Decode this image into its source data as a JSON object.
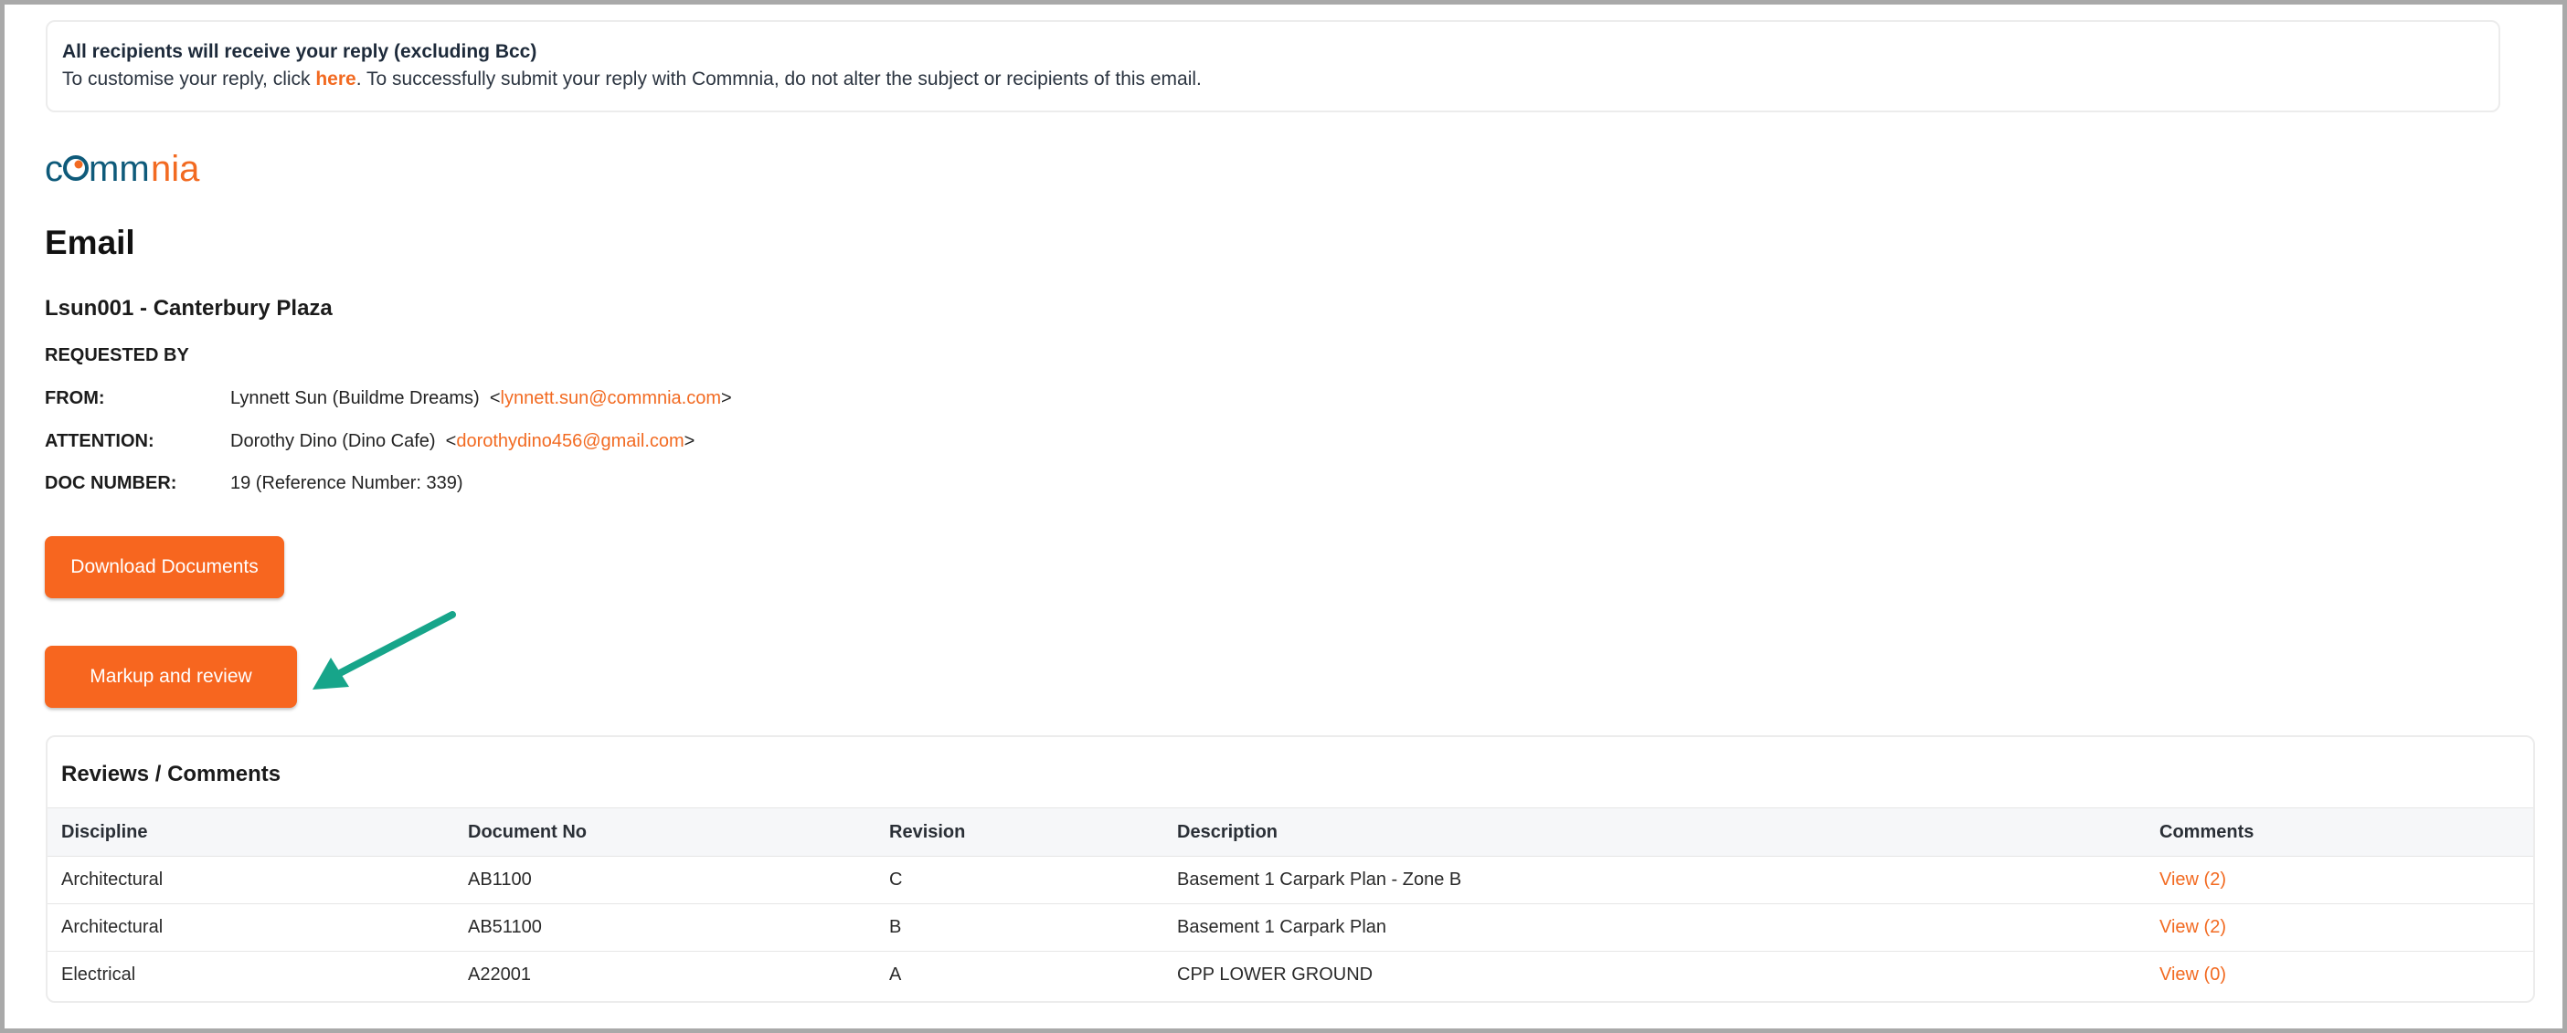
{
  "notice": {
    "title": "All recipients will receive your reply (excluding Bcc)",
    "body_prefix": "To customise your reply, click ",
    "link_text": "here",
    "body_suffix": ". To successfully submit your reply with Commnia, do not alter the subject or recipients of this email."
  },
  "logo": {
    "text": "commnia",
    "colors": {
      "primary": "#0e5a7a",
      "accent": "#f26a21"
    }
  },
  "page_title": "Email",
  "project_title": "Lsun001 - Canterbury Plaza",
  "requested_by_label": "REQUESTED BY",
  "from": {
    "label": "FROM:",
    "name": "Lynnett Sun  (Buildme Dreams)",
    "email": "lynnett.sun@commnia.com"
  },
  "attention": {
    "label": "ATTENTION:",
    "name": "Dorothy Dino (Dino Cafe)",
    "email": "dorothydino456@gmail.com"
  },
  "doc_number": {
    "label": "DOC NUMBER:",
    "value": "19 (Reference Number: 339)"
  },
  "buttons": {
    "download": "Download Documents",
    "markup": "Markup and review"
  },
  "reviews": {
    "title": "Reviews / Comments",
    "columns": [
      "Discipline",
      "Document No",
      "Revision",
      "Description",
      "Comments"
    ],
    "rows": [
      [
        "Architectural",
        "AB1100",
        "C",
        "Basement 1 Carpark Plan - Zone B",
        "View (2)"
      ],
      [
        "Architectural",
        "AB51100",
        "B",
        "Basement 1 Carpark Plan",
        "View (2)"
      ],
      [
        "Electrical",
        "A22001",
        "A",
        "CPP LOWER GROUND",
        "View (0)"
      ]
    ]
  },
  "colors": {
    "accent": "#f26a21",
    "button": "#f7661f",
    "arrow": "#17a58a"
  },
  "annotation_icon": "arrow-pointer-icon"
}
